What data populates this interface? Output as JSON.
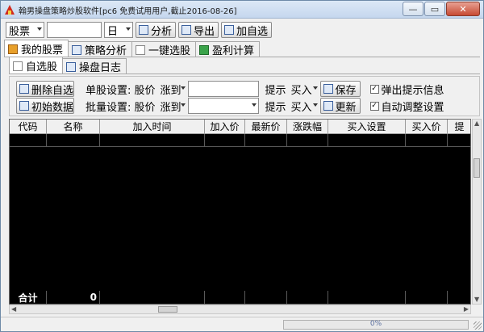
{
  "window": {
    "title": "翰男操盘策略炒股软件[pc6 免费试用用户,截止2016-08-26]",
    "min_glyph": "—",
    "max_glyph": "▭",
    "close_glyph": "✕"
  },
  "toolbar": {
    "market_select": "股票",
    "period_select": "日",
    "analyze_label": "分析",
    "export_label": "导出",
    "add_watch_label": "加自选"
  },
  "main_tabs": [
    {
      "label": "我的股票",
      "icon": "folder-icon"
    },
    {
      "label": "策略分析",
      "icon": "document-icon"
    },
    {
      "label": "一键选股",
      "icon": "blank-page-icon"
    },
    {
      "label": "盈利计算",
      "icon": "calculator-icon"
    }
  ],
  "sub_tabs": [
    {
      "label": "自选股",
      "icon": "blank-page-icon"
    },
    {
      "label": "操盘日志",
      "icon": "log-icon"
    }
  ],
  "settings": {
    "delete_watch_label": "删除自选",
    "init_data_label": "初始数据",
    "single_label": "单股设置: 股价",
    "single_cond": "涨到",
    "batch_label": "批量设置: 股价",
    "batch_cond": "涨到",
    "tip_label": "提示",
    "tip_single": "买入",
    "tip_batch": "买入",
    "save_label": "保存",
    "update_label": "更新",
    "popup_tip_label": "弹出提示信息",
    "auto_adjust_label": "自动调整设置",
    "popup_checked": true,
    "auto_checked": true
  },
  "grid": {
    "columns": [
      "代码",
      "名称",
      "加入时间",
      "加入价",
      "最新价",
      "涨跌幅",
      "买入设置",
      "买入价",
      "提"
    ],
    "footer_label": "合计",
    "footer_count": "0"
  },
  "status": {
    "progress_text": "0%",
    "progress_value": 0
  }
}
